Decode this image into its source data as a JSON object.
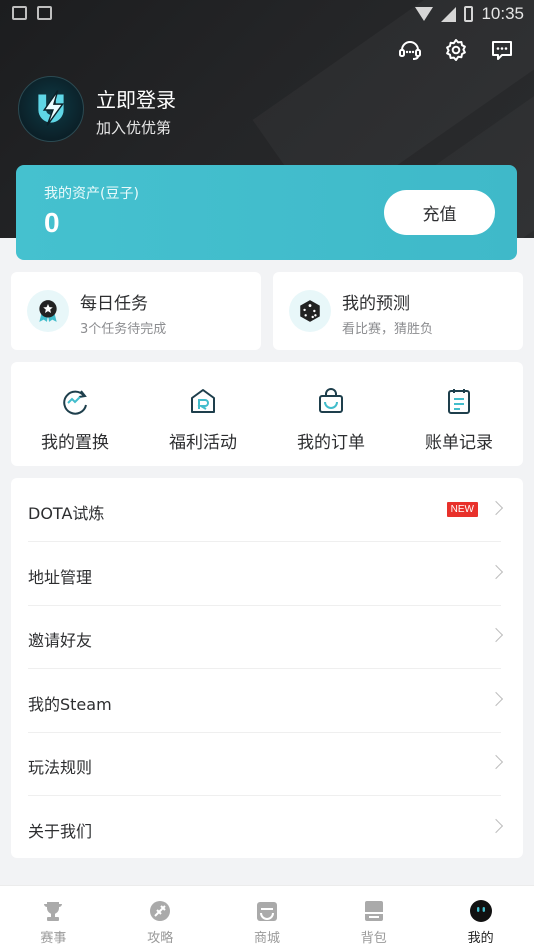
{
  "status_bar": {
    "time": "10:35"
  },
  "profile": {
    "login_title": "立即登录",
    "login_subtitle": "加入优优第"
  },
  "asset": {
    "label": "我的资产(豆子)",
    "value": "0",
    "recharge_label": "充值"
  },
  "tasks": [
    {
      "title": "每日任务",
      "subtitle": "3个任务待完成",
      "icon": "ribbon-star-icon"
    },
    {
      "title": "我的预测",
      "subtitle": "看比赛，猜胜负",
      "icon": "dice-icon"
    }
  ],
  "quick_actions": [
    {
      "label": "我的置换",
      "icon": "exchange-icon"
    },
    {
      "label": "福利活动",
      "icon": "gift-house-icon"
    },
    {
      "label": "我的订单",
      "icon": "shopping-bag-icon"
    },
    {
      "label": "账单记录",
      "icon": "bill-icon"
    }
  ],
  "menu": [
    {
      "label": "DOTA试炼",
      "badge": "NEW"
    },
    {
      "label": "地址管理"
    },
    {
      "label": "邀请好友"
    },
    {
      "label": "我的Steam"
    },
    {
      "label": "玩法规则"
    },
    {
      "label": "关于我们"
    }
  ],
  "tabs": [
    {
      "label": "赛事",
      "icon": "trophy-icon"
    },
    {
      "label": "攻略",
      "icon": "guide-icon"
    },
    {
      "label": "商城",
      "icon": "store-icon"
    },
    {
      "label": "背包",
      "icon": "backpack-icon"
    },
    {
      "label": "我的",
      "icon": "profile-face-icon",
      "active": true
    }
  ],
  "colors": {
    "accent": "#42bdcc",
    "header_bg": "#222325",
    "badge_red": "#e8312b"
  }
}
